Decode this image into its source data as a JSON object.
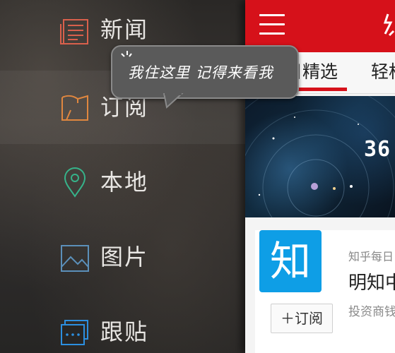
{
  "drawer": {
    "items": [
      {
        "label": "新闻",
        "icon": "newspaper-icon",
        "color": "#d9604c"
      },
      {
        "label": "订阅",
        "icon": "subscription-book-icon",
        "color": "#e0873f"
      },
      {
        "label": "本地",
        "icon": "location-pin-icon",
        "color": "#36b38a"
      },
      {
        "label": "图片",
        "icon": "image-icon",
        "color": "#5b8fb9"
      },
      {
        "label": "跟贴",
        "icon": "comments-icon",
        "color": "#2c8fe0"
      }
    ]
  },
  "tooltip": {
    "text": "我住这里 记得来看我"
  },
  "topbar": {
    "menu_icon": "hamburger-menu-icon",
    "brand_color": "#d6111a"
  },
  "tabs": {
    "items": [
      "日精选",
      "轻松"
    ],
    "active": "日精选"
  },
  "banner": {
    "number": "36"
  },
  "card": {
    "logo_text": "知",
    "subscribe_label": "订阅",
    "subscribe_icon": "plus-icon",
    "source": "知乎每日",
    "title": "明知中",
    "description": "投资商钱的事情"
  }
}
